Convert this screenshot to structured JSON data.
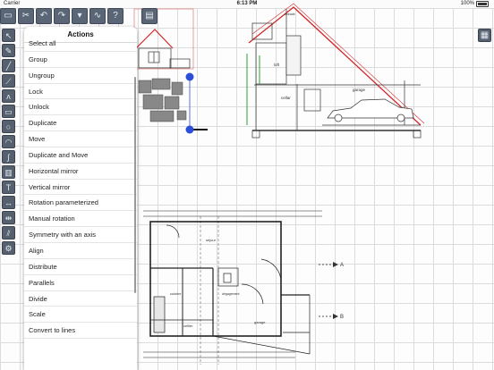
{
  "status_bar": {
    "carrier": "Carrier",
    "time": "6:13 PM",
    "battery": "100%"
  },
  "toolbar": {
    "buttons": [
      {
        "name": "open-file-icon",
        "glyph": "▭"
      },
      {
        "name": "cut-tool-icon",
        "glyph": "✂"
      },
      {
        "name": "undo-icon",
        "glyph": "↶"
      },
      {
        "name": "redo-icon",
        "glyph": "↷"
      },
      {
        "name": "dropdown-icon",
        "glyph": "▾"
      },
      {
        "name": "zigzag-icon",
        "glyph": "∿"
      },
      {
        "name": "help-icon",
        "glyph": "?"
      },
      {
        "name": "layers-icon",
        "glyph": "▤"
      }
    ]
  },
  "side_tools": [
    {
      "name": "select-tool-icon",
      "glyph": "↖"
    },
    {
      "name": "pencil-tool-icon",
      "glyph": "✎"
    },
    {
      "name": "line-tool-icon",
      "glyph": "╱"
    },
    {
      "name": "polyline-tool-icon",
      "glyph": "⟋"
    },
    {
      "name": "zigzag-tool-icon",
      "glyph": "ʌ"
    },
    {
      "name": "rectangle-tool-icon",
      "glyph": "▭"
    },
    {
      "name": "circle-tool-icon",
      "glyph": "○"
    },
    {
      "name": "arc-tool-icon",
      "glyph": "◠"
    },
    {
      "name": "curve-tool-icon",
      "glyph": "∫"
    },
    {
      "name": "hatch-tool-icon",
      "glyph": "▥"
    },
    {
      "name": "text-tool-icon",
      "glyph": "T"
    },
    {
      "name": "dimension-tool-icon",
      "glyph": "↔"
    },
    {
      "name": "measure-tool-icon",
      "glyph": "⇹"
    },
    {
      "name": "wall-tool-icon",
      "glyph": "⫽"
    },
    {
      "name": "settings-tool-icon",
      "glyph": "⚙"
    }
  ],
  "right_button": {
    "name": "grid-panel-icon",
    "glyph": "▦"
  },
  "menu": {
    "title": "Actions",
    "items": [
      "Select all",
      "Group",
      "Ungroup",
      "Lock",
      "Unlock",
      "Duplicate",
      "Move",
      "Duplicate and Move",
      "Horizontal mirror",
      "Vertical mirror",
      "Rotation parameterized",
      "Manual rotation",
      "Symmetry with an axis",
      "Align",
      "Distribute",
      "Parallels",
      "Divide",
      "Scale",
      "Convert to lines"
    ]
  },
  "drawing": {
    "section_labels": {
      "loft": "loft",
      "cellar": "cellar",
      "garage": "garage",
      "top_note": "extrade"
    },
    "plan_labels": {
      "sejour": "séjour",
      "cuisine": "cuisine",
      "cellier": "cellier",
      "garage": "garage",
      "degagement": "dégagement"
    },
    "axis_labels": {
      "a": "A",
      "b": "B"
    },
    "colors": {
      "roof": "#d2272a",
      "line": "#222222",
      "selection": "#2b4fd6"
    }
  }
}
